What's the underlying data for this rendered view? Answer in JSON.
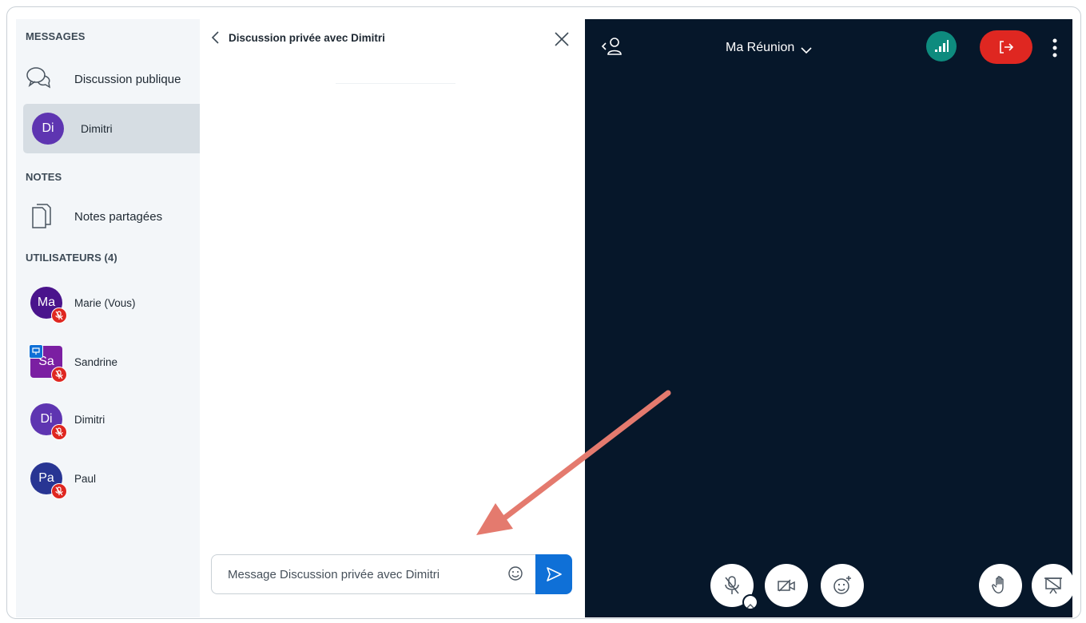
{
  "sidebar": {
    "messages_title": "MESSAGES",
    "public_chat_label": "Discussion publique",
    "private_chat": {
      "initials": "Di",
      "name": "Dimitri"
    },
    "notes_title": "NOTES",
    "shared_notes_label": "Notes partagées",
    "users_title": "UTILISATEURS (4)",
    "users": [
      {
        "initials": "Ma",
        "name": "Marie (Vous)",
        "color": "#4a148c"
      },
      {
        "initials": "Sa",
        "name": "Sandrine",
        "color": "#7b1fa2"
      },
      {
        "initials": "Di",
        "name": "Dimitri",
        "color": "#5e35b1"
      },
      {
        "initials": "Pa",
        "name": "Paul",
        "color": "#283593"
      }
    ]
  },
  "chat": {
    "title": "Discussion privée avec Dimitri",
    "input_placeholder": "Message Discussion privée avec Dimitri"
  },
  "meeting": {
    "title": "Ma Réunion"
  },
  "colors": {
    "accent_blue": "#0f70d7",
    "leave_red": "#df2721",
    "connection_teal": "#0e8b7e",
    "meeting_bg": "#06172a",
    "annotation_arrow": "#e47a6e"
  }
}
